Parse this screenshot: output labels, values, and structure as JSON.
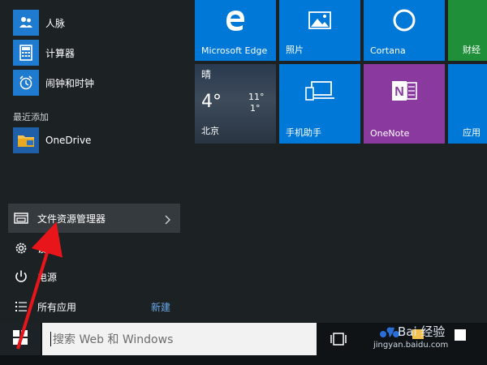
{
  "left": {
    "apps": [
      {
        "label": "人脉",
        "icon": "people-icon"
      },
      {
        "label": "计算器",
        "icon": "calculator-icon"
      },
      {
        "label": "闹钟和时钟",
        "icon": "alarm-clock-icon"
      }
    ],
    "recent_title": "最近添加",
    "recent_app": {
      "label": "OneDrive",
      "icon": "onedrive-folder-icon"
    },
    "explorer_label": "文件资源管理器",
    "settings_label": "设置",
    "power_label": "电源",
    "all_apps_label": "所有应用",
    "new_label": "新建"
  },
  "tiles": {
    "edge": "Microsoft Edge",
    "photos": "照片",
    "cortana": "Cortana",
    "finance": "财经",
    "weather": {
      "condition": "晴",
      "temp": "4°",
      "high": "11°",
      "low": "1°",
      "city": "北京"
    },
    "phone": "手机助手",
    "onenote": "OneNote",
    "store": "应用"
  },
  "taskbar": {
    "search_placeholder": "搜索 Web 和 Windows"
  },
  "watermark": {
    "brand": "Bai 经验",
    "url": "jingyan.baidu.com"
  },
  "colors": {
    "tile_blue": "#0078d7",
    "onenote_purple": "#8a3a9e",
    "finance_green": "#1f8f3a",
    "arrow_red": "#e8161b"
  }
}
